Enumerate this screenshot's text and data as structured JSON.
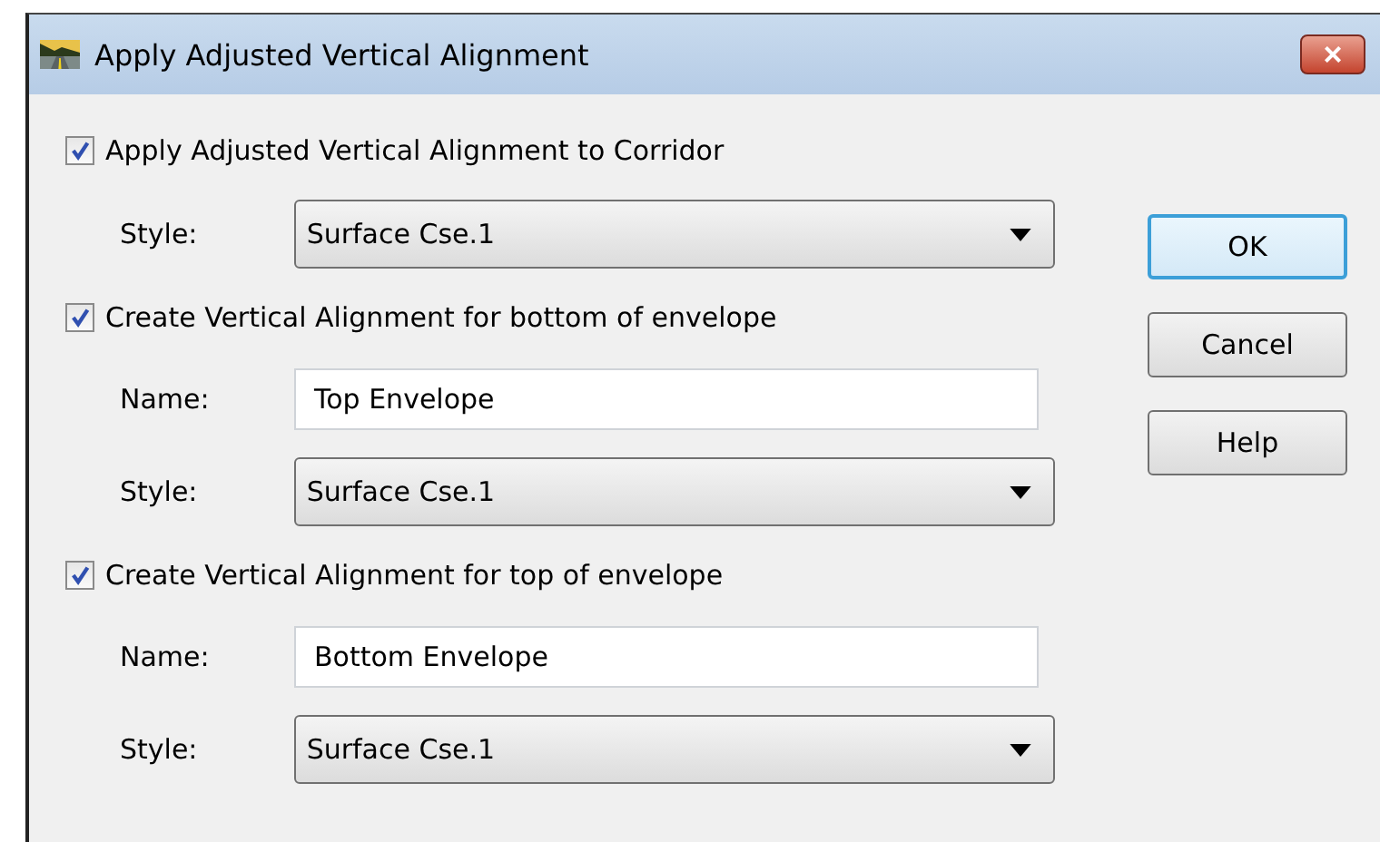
{
  "window": {
    "title": "Apply Adjusted Vertical Alignment",
    "close_label": "×"
  },
  "groups": [
    {
      "label": "Apply Adjusted Vertical Alignment to Corridor",
      "checked": true,
      "fields": [
        {
          "kind": "dropdown",
          "label": "Style:",
          "value": "Surface Cse.1"
        }
      ]
    },
    {
      "label": "Create Vertical Alignment for bottom of envelope",
      "checked": true,
      "fields": [
        {
          "kind": "text",
          "label": "Name:",
          "value": "Top Envelope"
        },
        {
          "kind": "dropdown",
          "label": "Style:",
          "value": "Surface Cse.1"
        }
      ]
    },
    {
      "label": "Create Vertical Alignment for top of envelope",
      "checked": true,
      "fields": [
        {
          "kind": "text",
          "label": "Name:",
          "value": "Bottom Envelope"
        },
        {
          "kind": "dropdown",
          "label": "Style:",
          "value": "Surface Cse.1"
        }
      ]
    }
  ],
  "buttons": [
    {
      "label": "OK",
      "default": true
    },
    {
      "label": "Cancel",
      "default": false
    },
    {
      "label": "Help",
      "default": false
    }
  ]
}
